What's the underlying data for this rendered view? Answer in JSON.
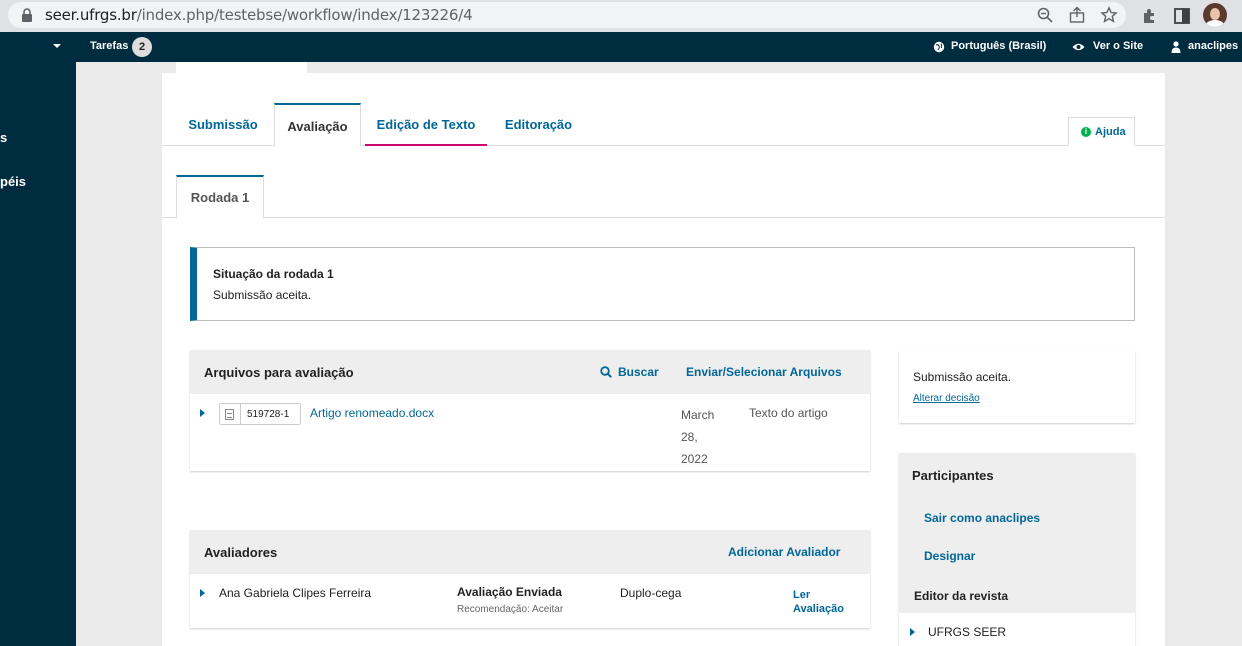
{
  "browser": {
    "url_host": "seer.ufrgs.br",
    "url_path": "/index.php/testebse/workflow/index/123226/4"
  },
  "topbar": {
    "tasks_label": "Tarefas",
    "tasks_count": "2",
    "language": "Português (Brasil)",
    "view_site": "Ver o Site",
    "username": "anaclipes"
  },
  "leftnav": {
    "items": [
      "s",
      "péis"
    ]
  },
  "stage_tabs": {
    "submission": "Submissão",
    "review": "Avaliação",
    "copyediting": "Edição de Texto",
    "production": "Editoração",
    "help": "Ajuda"
  },
  "round": {
    "tab_label": "Rodada 1",
    "status_title": "Situação da rodada 1",
    "status_text": "Submissão aceita."
  },
  "review_files": {
    "title": "Arquivos para avaliação",
    "search_label": "Buscar",
    "upload_label": "Enviar/Selecionar Arquivos",
    "files": [
      {
        "id": "519728-1",
        "name": "Artigo renomeado.docx",
        "date": "March 28, 2022",
        "type": "Texto do artigo"
      }
    ]
  },
  "reviewers": {
    "title": "Avaliadores",
    "add_label": "Adicionar Avaliador",
    "rows": [
      {
        "name": "Ana Gabriela Clipes Ferreira",
        "status": "Avaliação Enviada",
        "recommendation": "Recomendação: Aceitar",
        "method": "Duplo-cega",
        "action": "Ler Avaliação"
      }
    ]
  },
  "decision": {
    "text": "Submissão aceita.",
    "change_link": "Alterar decisão"
  },
  "participants": {
    "title": "Participantes",
    "logout_as": "Sair como anaclipes",
    "assign": "Designar",
    "group": "Editor da revista",
    "members": [
      "UFRGS SEER"
    ]
  },
  "colors": {
    "topbar_bg": "#002c40",
    "link": "#006798",
    "copyediting_underline": "#d00a6c",
    "help_icon": "#00b24e"
  }
}
